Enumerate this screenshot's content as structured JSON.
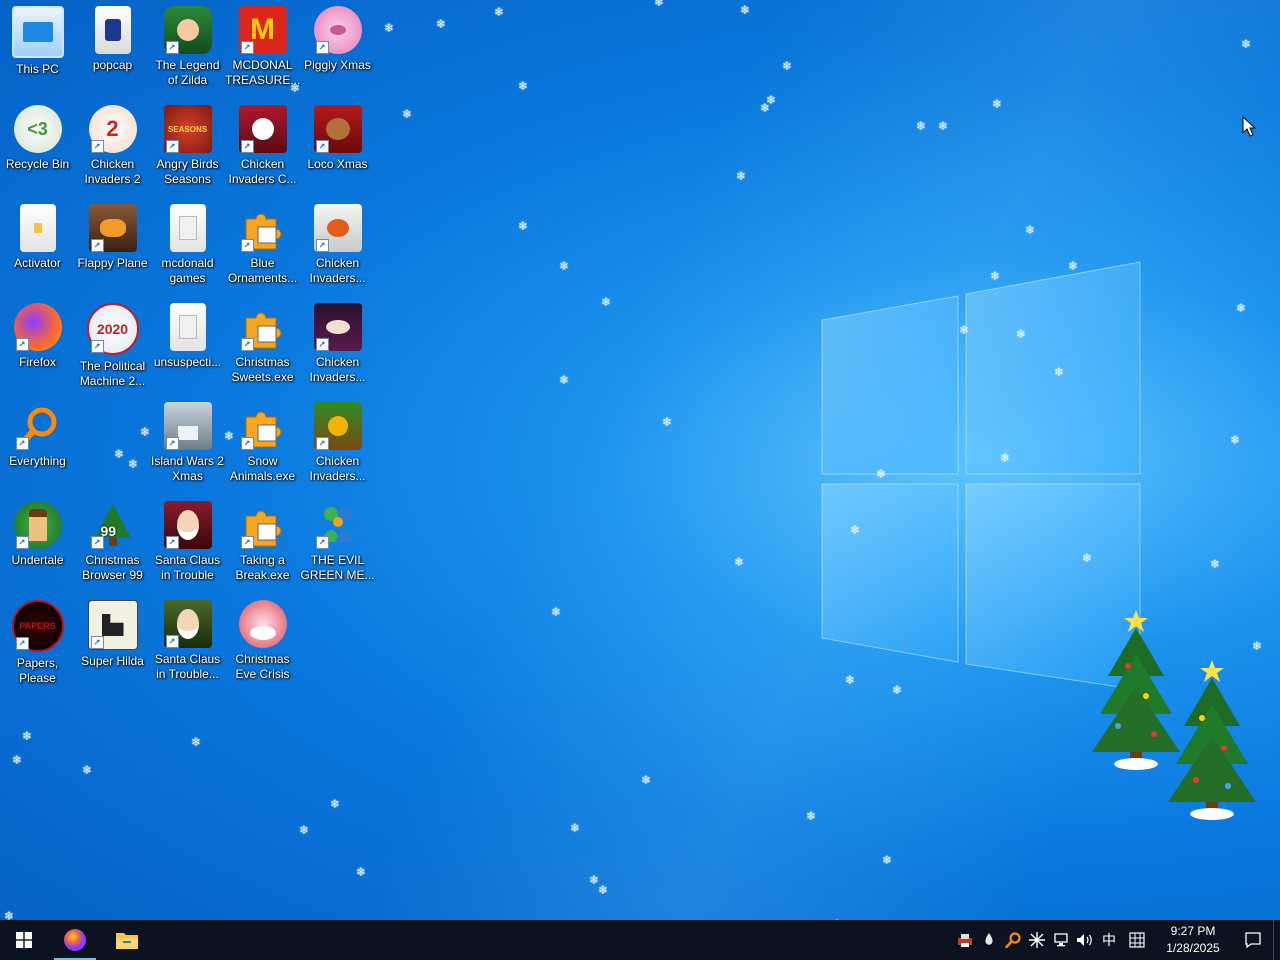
{
  "desktop": {
    "icons": [
      {
        "label": "This PC"
      },
      {
        "label": "popcap"
      },
      {
        "label": "The Legend\nof Zilda"
      },
      {
        "label": "MCDONAL\nTREASURE..."
      },
      {
        "label": "Piggly Xmas"
      },
      {
        "label": "Recycle Bin"
      },
      {
        "label": "Chicken\nInvaders 2"
      },
      {
        "label": "Angry Birds\nSeasons"
      },
      {
        "label": "Chicken\nInvaders C..."
      },
      {
        "label": "Loco Xmas"
      },
      {
        "label": "Activator"
      },
      {
        "label": "Flappy Plane"
      },
      {
        "label": "mcdonald\ngames"
      },
      {
        "label": "Blue\nOrnaments..."
      },
      {
        "label": "Chicken\nInvaders..."
      },
      {
        "label": "Firefox"
      },
      {
        "label": "The Political\nMachine 2..."
      },
      {
        "label": "unsuspecti..."
      },
      {
        "label": "Christmas\nSweets.exe"
      },
      {
        "label": "Chicken\nInvaders..."
      },
      {
        "label": "Everything"
      },
      {
        "label": "Island Wars 2\nXmas"
      },
      {
        "label": "Snow\nAnimals.exe"
      },
      {
        "label": "Chicken\nInvaders..."
      },
      {
        "label": "Undertale"
      },
      {
        "label": "Christmas\nBrowser 99"
      },
      {
        "label": "Santa Claus\nin Trouble"
      },
      {
        "label": "Taking a\nBreak.exe"
      },
      {
        "label": "THE EVIL\nGREEN ME..."
      },
      {
        "label": "Papers,\nPlease"
      },
      {
        "label": "Super Hilda"
      },
      {
        "label": "Santa Claus\nin Trouble..."
      },
      {
        "label": "Christmas\nEve Crisis"
      }
    ]
  },
  "taskbar": {
    "ime_label": "中",
    "time": "9:27 PM",
    "date": "1/28/2025"
  },
  "colors": {
    "taskbar": "#0b1320",
    "accent": "#76b9ed"
  }
}
